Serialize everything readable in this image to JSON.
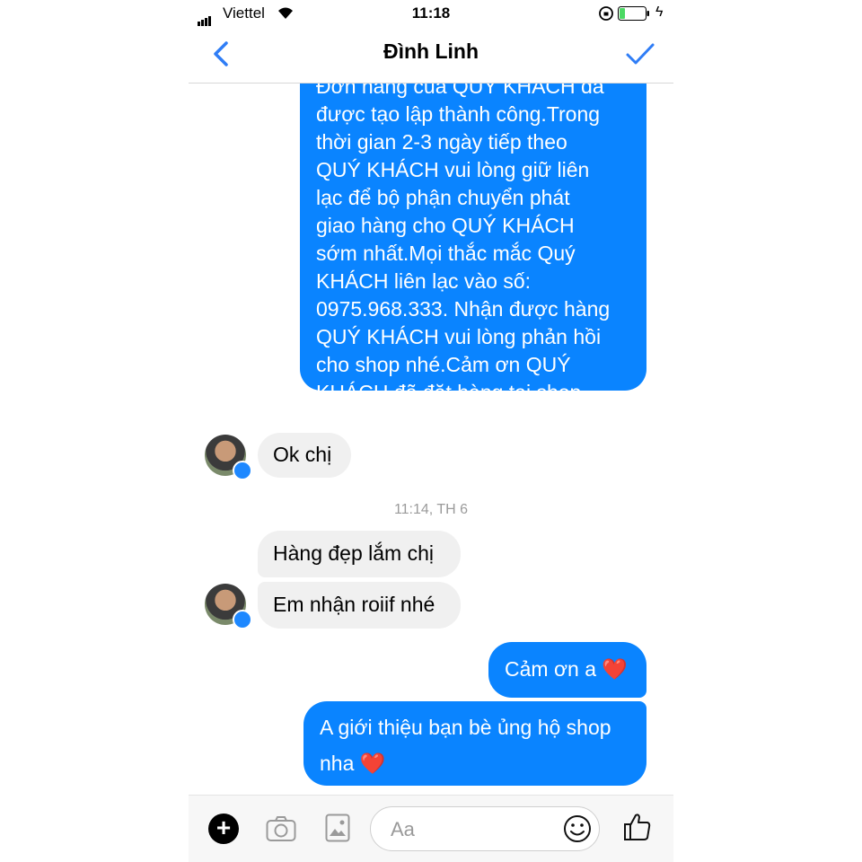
{
  "status_bar": {
    "carrier": "Viettel",
    "time": "11:18"
  },
  "header": {
    "title": "Đình Linh",
    "back_icon": "chevron-left-icon",
    "done_icon": "checkmark-icon"
  },
  "messages": {
    "outgoing_long": {
      "lines": [
        "Đơn hàng của QUÝ KHÁCH đã",
        "được tạo lập thành công.Trong",
        "thời gian 2-3 ngày tiếp theo",
        "QUÝ KHÁCH vui lòng giữ liên",
        "lạc để bộ phận chuyển phát",
        "giao hàng cho QUÝ KHÁCH",
        "sớm nhất.Mọi thắc mắc Quý",
        "KHÁCH liên lạc vào số:",
        "0975.968.333. Nhận được hàng",
        "QUÝ KHÁCH vui lòng phản hồi",
        "cho shop nhé.Cảm ơn QUÝ",
        "KHÁCH đã đặt hàng tại shop"
      ]
    },
    "incoming_1": "Ok chị",
    "timestamp": "11:14, TH 6",
    "incoming_2": "Hàng đẹp lắm chị",
    "incoming_3": "Em nhận roiif nhé",
    "outgoing_1": "Cảm ơn a",
    "outgoing_2_line1": "A giới thiệu bạn bè ủng hộ shop",
    "outgoing_2_line2": "nha",
    "heart": "❤️"
  },
  "composer": {
    "placeholder": "Aa",
    "icons": [
      "plus-icon",
      "camera-icon",
      "photo-icon",
      "smiley-icon",
      "thumbs-up-icon"
    ]
  },
  "colors": {
    "accent": "#0a84ff",
    "incoming_bubble": "#f0f0f0",
    "heart": "#e0242f"
  }
}
